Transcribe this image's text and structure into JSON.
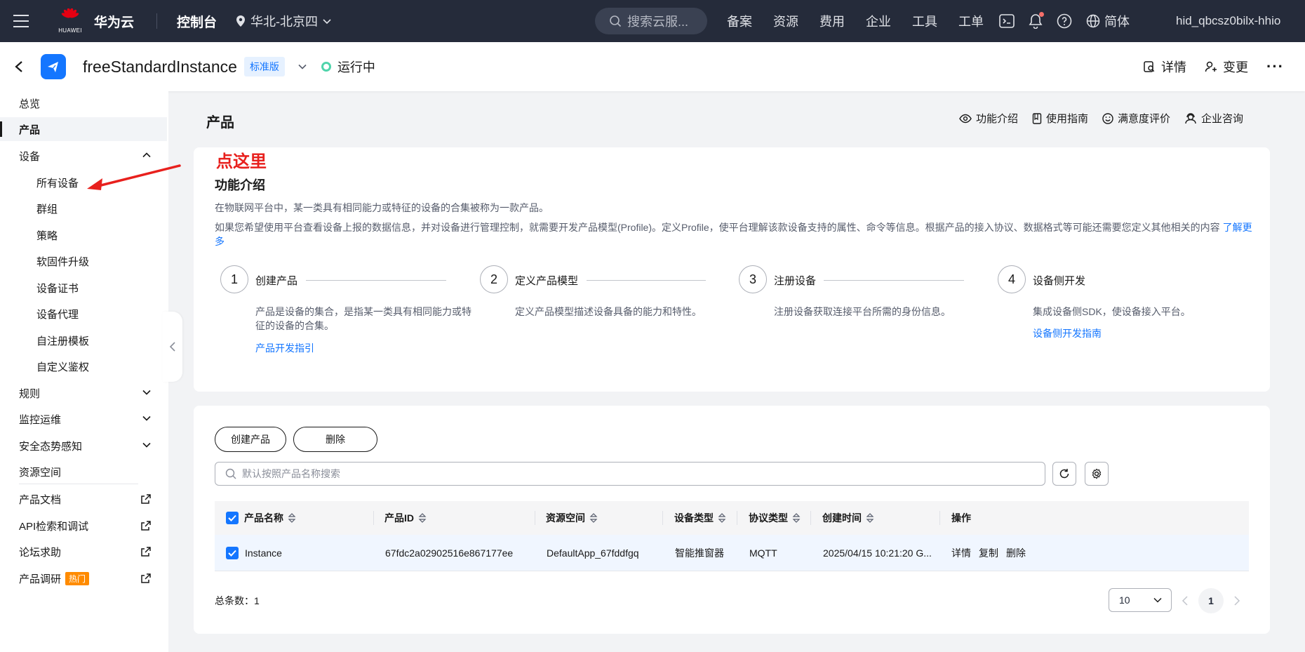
{
  "topbar": {
    "brand_sub": "HUAWEI",
    "brand": "华为云",
    "console": "控制台",
    "region": "华北-北京四",
    "search_placeholder": "搜索云服...",
    "links": [
      "备案",
      "资源",
      "费用",
      "企业",
      "工具",
      "工单"
    ],
    "lang": "简体",
    "user": "hid_qbcsz0bilx-hhio"
  },
  "header": {
    "instance_name": "freeStandardInstance",
    "edition_tag": "标准版",
    "status": "运行中",
    "details_label": "详情",
    "change_label": "变更",
    "more_label": "···"
  },
  "sidebar": {
    "items": [
      {
        "label": "总览"
      },
      {
        "label": "产品"
      },
      {
        "label": "设备"
      },
      {
        "label": "所有设备"
      },
      {
        "label": "群组"
      },
      {
        "label": "策略"
      },
      {
        "label": "软固件升级"
      },
      {
        "label": "设备证书"
      },
      {
        "label": "设备代理"
      },
      {
        "label": "自注册模板"
      },
      {
        "label": "自定义鉴权"
      },
      {
        "label": "规则"
      },
      {
        "label": "监控运维"
      },
      {
        "label": "安全态势感知"
      },
      {
        "label": "资源空间"
      },
      {
        "label": "产品文档"
      },
      {
        "label": "API检索和调试"
      },
      {
        "label": "论坛求助"
      },
      {
        "label": "产品调研"
      }
    ],
    "hot_badge": "热门"
  },
  "main": {
    "title": "产品",
    "page_links": [
      "功能介绍",
      "使用指南",
      "满意度评价",
      "企业咨询"
    ],
    "annotation": "点这里",
    "intro": {
      "heading": "功能介绍",
      "p1": "在物联网平台中，某一类具有相同能力或特征的设备的合集被称为一款产品。",
      "p2": "如果您希望使用平台查看设备上报的数据信息，并对设备进行管理控制，就需要开发产品模型(Profile)。定义Profile，使平台理解该款设备支持的属性、命令等信息。根据产品的接入协议、数据格式等可能还需要您定义其他相关的内容",
      "learn_more": "了解更多",
      "steps": [
        {
          "num": "1",
          "title": "创建产品",
          "desc": "产品是设备的集合，是指某一类具有相同能力或特征的设备的合集。",
          "link": "产品开发指引"
        },
        {
          "num": "2",
          "title": "定义产品模型",
          "desc": "定义产品模型描述设备具备的能力和特性。",
          "link": ""
        },
        {
          "num": "3",
          "title": "注册设备",
          "desc": "注册设备获取连接平台所需的身份信息。",
          "link": ""
        },
        {
          "num": "4",
          "title": "设备侧开发",
          "desc": "集成设备侧SDK，使设备接入平台。",
          "link": "设备侧开发指南"
        }
      ]
    },
    "list": {
      "create_btn": "创建产品",
      "delete_btn": "删除",
      "search_placeholder": "默认按照产品名称搜索",
      "columns": [
        "产品名称",
        "产品ID",
        "资源空间",
        "设备类型",
        "协议类型",
        "创建时间",
        "操作"
      ],
      "rows": [
        {
          "name": "Instance",
          "id": "67fdc2a02902516e867177ee",
          "space": "DefaultApp_67fddfgq",
          "device_type": "智能推窗器",
          "protocol": "MQTT",
          "created": "2025/04/15 10:21:20 G...",
          "actions": [
            "详情",
            "复制",
            "删除"
          ]
        }
      ],
      "total_label": "总条数：",
      "total": "1",
      "page_size": "10",
      "current_page": "1"
    }
  }
}
